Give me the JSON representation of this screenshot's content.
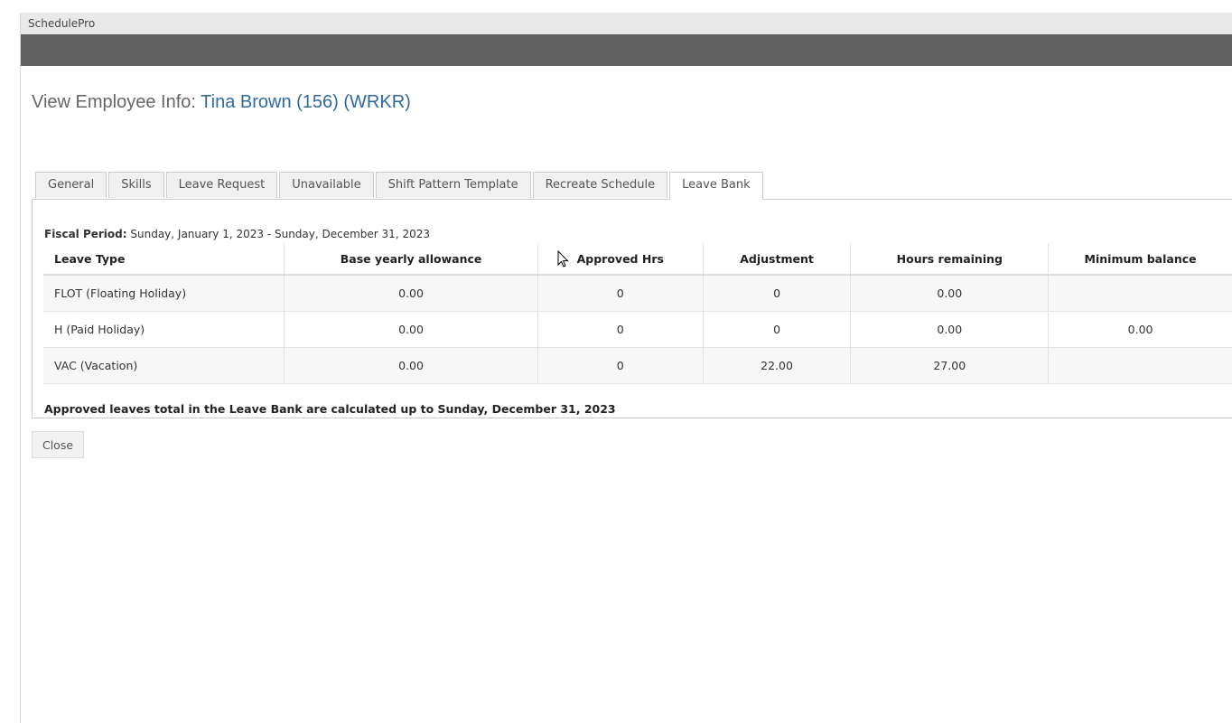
{
  "app": {
    "title": "SchedulePro"
  },
  "page": {
    "heading_prefix": "View Employee Info: ",
    "employee": "Tina Brown (156) (WRKR)"
  },
  "tabs": [
    {
      "label": "General"
    },
    {
      "label": "Skills"
    },
    {
      "label": "Leave Request"
    },
    {
      "label": "Unavailable"
    },
    {
      "label": "Shift Pattern Template"
    },
    {
      "label": "Recreate Schedule"
    },
    {
      "label": "Leave Bank",
      "active": true
    }
  ],
  "fiscal": {
    "label": "Fiscal Period:",
    "value": " Sunday, January 1, 2023 - Sunday, December 31, 2023"
  },
  "table": {
    "headers": [
      "Leave Type",
      "Base yearly allowance",
      "Approved Hrs",
      "Adjustment",
      "Hours remaining",
      "Minimum balance"
    ],
    "rows": [
      [
        "FLOT (Floating Holiday)",
        "0.00",
        "0",
        "0",
        "0.00",
        ""
      ],
      [
        "H (Paid Holiday)",
        "0.00",
        "0",
        "0",
        "0.00",
        "0.00"
      ],
      [
        "VAC (Vacation)",
        "0.00",
        "0",
        "22.00",
        "27.00",
        ""
      ]
    ]
  },
  "note": "Approved leaves total in the Leave Bank are calculated up to Sunday, December 31, 2023",
  "buttons": {
    "close": "Close"
  }
}
